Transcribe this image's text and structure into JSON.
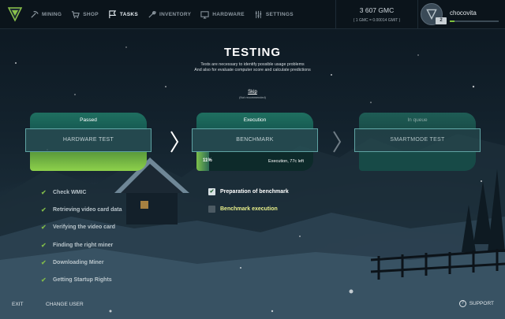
{
  "nav": {
    "items": [
      {
        "label": "MINING",
        "icon": "pickaxe-icon",
        "active": false
      },
      {
        "label": "SHOP",
        "icon": "cart-icon",
        "active": false
      },
      {
        "label": "TASKS",
        "icon": "flag-icon",
        "active": true
      },
      {
        "label": "INVENTORY",
        "icon": "wrench-icon",
        "active": false
      },
      {
        "label": "HARDWARE",
        "icon": "monitor-icon",
        "active": false
      },
      {
        "label": "SETTINGS",
        "icon": "sliders-icon",
        "active": false
      }
    ]
  },
  "balance": {
    "gmc": "3 607 GMC",
    "rate": "( 1 GMC = 0.00014 GMIT )"
  },
  "user": {
    "name": "chocovita",
    "level": "2",
    "xp_progress": 0.1
  },
  "page": {
    "title": "TESTING",
    "desc_line1": "Tests are necessary to identify possible usage problems",
    "desc_line2": "And also for evaluate computer score and calculate predictions",
    "skip": "Skip",
    "skip_note": "(Not recommended)"
  },
  "stages": [
    {
      "status": "Passed",
      "name": "HARDWARE TEST"
    },
    {
      "status": "Execution",
      "name": "BENCHMARK",
      "progress_text": "11%",
      "progress": 0.11,
      "eta": "Execution, 77c left"
    },
    {
      "status": "In queue",
      "name": "SMARTMODE TEST"
    }
  ],
  "hardware_checks": [
    "Check WMIC",
    "Retrieving video card data",
    "Verifying the video card",
    "Finding the right miner",
    "Downloading Miner",
    "Getting Startup Rights"
  ],
  "benchmark_steps": [
    {
      "label": "Preparation of benchmark",
      "checked": true
    },
    {
      "label": "Benchmark execution",
      "checked": false
    }
  ],
  "footer": {
    "exit": "EXIT",
    "change_user": "CHANGE USER",
    "support": "SUPPORT"
  },
  "colors": {
    "accent_green": "#7dc03c",
    "teal": "#1f6f60",
    "highlight": "#e9f08a"
  }
}
